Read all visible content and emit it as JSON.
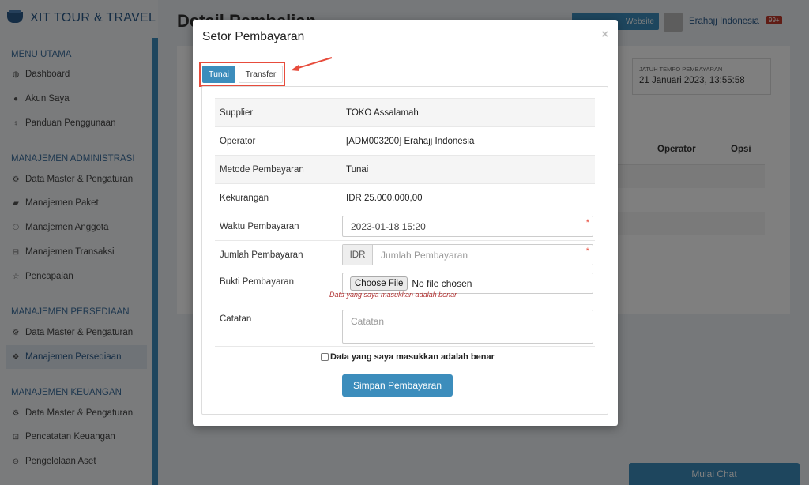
{
  "app": {
    "brand": "XIT TOUR & TRAVEL",
    "page_title": "Detail Pembelian",
    "website_button": "Website",
    "user_name": "Erahajj Indonesia",
    "user_badge": "99+",
    "chat_button": "Mulai Chat"
  },
  "sidebar": {
    "sections": [
      {
        "title": "MENU UTAMA",
        "items": [
          {
            "label": "Dashboard",
            "icon": "dashboard-icon",
            "glyph": "◍"
          },
          {
            "label": "Akun Saya",
            "icon": "user-icon",
            "glyph": "●"
          },
          {
            "label": "Panduan Penggunaan",
            "icon": "lightbulb-icon",
            "glyph": "♀"
          }
        ]
      },
      {
        "title": "MANAJEMEN ADMINISTRASI",
        "items": [
          {
            "label": "Data Master & Pengaturan",
            "icon": "gears-icon",
            "glyph": "⚙"
          },
          {
            "label": "Manajemen Paket",
            "icon": "book-icon",
            "glyph": "▰"
          },
          {
            "label": "Manajemen Anggota",
            "icon": "users-icon",
            "glyph": "⚇"
          },
          {
            "label": "Manajemen Transaksi",
            "icon": "cart-icon",
            "glyph": "⊟"
          },
          {
            "label": "Pencapaian",
            "icon": "star-icon",
            "glyph": "☆"
          }
        ]
      },
      {
        "title": "MANAJEMEN PERSEDIAAN",
        "items": [
          {
            "label": "Data Master & Pengaturan",
            "icon": "gears-icon",
            "glyph": "⚙"
          },
          {
            "label": "Manajemen Persediaan",
            "icon": "cubes-icon",
            "glyph": "❖"
          }
        ]
      },
      {
        "title": "MANAJEMEN KEUANGAN",
        "items": [
          {
            "label": "Data Master & Pengaturan",
            "icon": "gears-icon",
            "glyph": "⚙"
          },
          {
            "label": "Pencatatan Keuangan",
            "icon": "money-icon",
            "glyph": "⊡"
          },
          {
            "label": "Pengelolaan Aset",
            "icon": "hdd-icon",
            "glyph": "⊖"
          }
        ]
      }
    ]
  },
  "background": {
    "due_label": "JATUH TEMPO PEMBAYARAN",
    "due_value": "21 Januari 2023, 13:55:58",
    "col_operator": "Operator",
    "col_opsi": "Opsi"
  },
  "modal": {
    "title": "Setor Pembayaran",
    "close": "×",
    "tabs": {
      "tunai": "Tunai",
      "transfer": "Transfer"
    },
    "rows": {
      "supplier": {
        "label": "Supplier",
        "value": "TOKO Assalamah"
      },
      "operator": {
        "label": "Operator",
        "value": "[ADM003200] Erahajj Indonesia"
      },
      "metode": {
        "label": "Metode Pembayaran",
        "value": "Tunai"
      },
      "kekurangan": {
        "label": "Kekurangan",
        "value": "IDR 25.000.000,00"
      }
    },
    "waktu": {
      "label": "Waktu Pembayaran",
      "value": "2023-01-18 15:20"
    },
    "jumlah": {
      "label": "Jumlah Pembayaran",
      "addon": "IDR",
      "placeholder": "Jumlah Pembayaran"
    },
    "bukti": {
      "label": "Bukti Pembayaran",
      "button": "Choose File",
      "status": "No file chosen",
      "help": "Data yang saya masukkan adalah benar"
    },
    "catatan": {
      "label": "Catatan",
      "placeholder": "Catatan"
    },
    "confirm": "Data yang saya masukkan adalah benar",
    "submit": "Simpan Pembayaran",
    "required_mark": "*"
  },
  "colors": {
    "primary": "#3c8dbc",
    "highlight": "#e74c3c"
  }
}
